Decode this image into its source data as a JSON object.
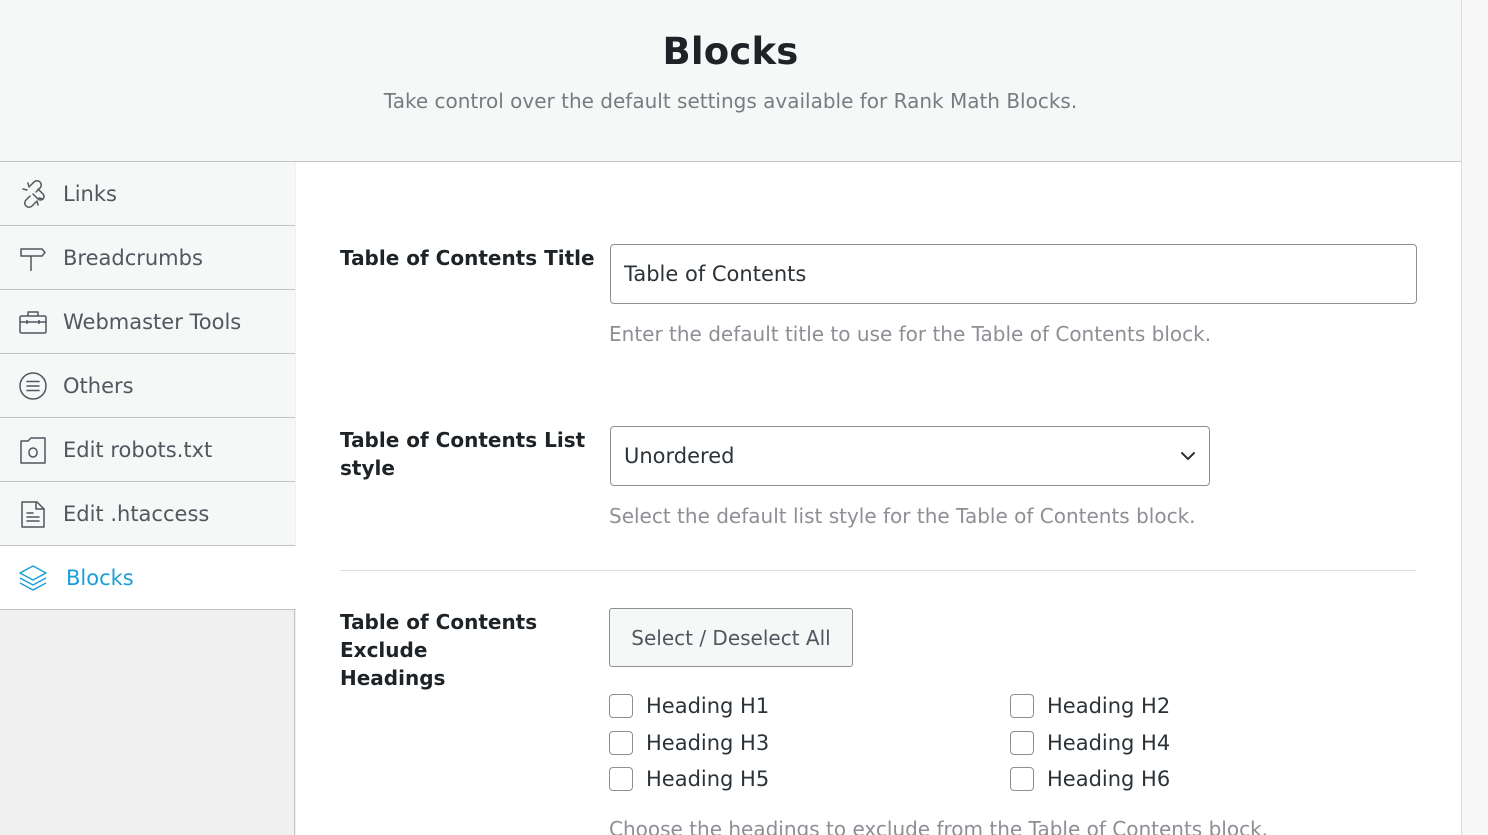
{
  "header": {
    "title": "Blocks",
    "subtitle": "Take control over the default settings available for Rank Math Blocks."
  },
  "sidebar": {
    "items": [
      {
        "label": "Links",
        "icon": "link-broken-icon",
        "active": false
      },
      {
        "label": "Breadcrumbs",
        "icon": "signpost-icon",
        "active": false
      },
      {
        "label": "Webmaster Tools",
        "icon": "toolbox-icon",
        "active": false
      },
      {
        "label": "Others",
        "icon": "list-circle-icon",
        "active": false
      },
      {
        "label": "Edit robots.txt",
        "icon": "robot-file-icon",
        "active": false
      },
      {
        "label": "Edit .htaccess",
        "icon": "document-icon",
        "active": false
      },
      {
        "label": "Blocks",
        "icon": "layers-icon",
        "active": true
      }
    ]
  },
  "settings": {
    "toc_title": {
      "label": "Table of Contents Title",
      "value": "Table of Contents",
      "description": "Enter the default title to use for the Table of Contents block."
    },
    "toc_list_style": {
      "label_line1": "Table of Contents List",
      "label_line2": "style",
      "selected": "Unordered",
      "description": "Select the default list style for the Table of Contents block."
    },
    "toc_exclude": {
      "label_line1": "Table of Contents Exclude",
      "label_line2": "Headings",
      "button_label": "Select / Deselect All",
      "headings": [
        {
          "label": "Heading H1",
          "checked": false
        },
        {
          "label": "Heading H2",
          "checked": false
        },
        {
          "label": "Heading H3",
          "checked": false
        },
        {
          "label": "Heading H4",
          "checked": false
        },
        {
          "label": "Heading H5",
          "checked": false
        },
        {
          "label": "Heading H6",
          "checked": false
        }
      ],
      "description": "Choose the headings to exclude from the Table of Contents block."
    }
  },
  "colors": {
    "accent": "#1a9fd8",
    "text": "#1d2327",
    "muted": "#8c8f94"
  }
}
